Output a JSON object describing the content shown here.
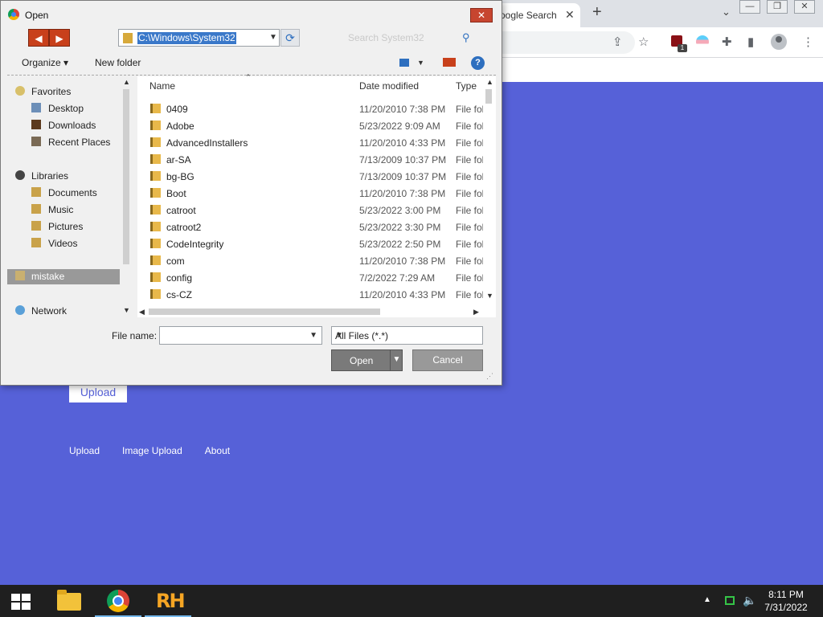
{
  "browser": {
    "tab_title": "oogle Search",
    "tab_close": "✕",
    "new_tab": "+",
    "page": {
      "upload_button": "Upload",
      "links": [
        "Upload",
        "Image Upload",
        "About"
      ]
    },
    "extension_badge": "1"
  },
  "dialog": {
    "title": "Open",
    "close_glyph": "✕",
    "address": "C:\\Windows\\System32",
    "search_placeholder": "Search System32",
    "toolbar": {
      "organize": "Organize ▾",
      "new_folder": "New folder",
      "help": "?"
    },
    "nav": {
      "favorites_header": "Favorites",
      "favorites": [
        "Desktop",
        "Downloads",
        "Recent Places"
      ],
      "libraries_header": "Libraries",
      "libraries": [
        "Documents",
        "Music",
        "Pictures",
        "Videos"
      ],
      "selected": "mistake",
      "network": "Network"
    },
    "columns": {
      "name": "Name",
      "date": "Date modified",
      "type": "Type"
    },
    "files": [
      {
        "name": "0409",
        "date": "11/20/2010 7:38 PM",
        "type": "File folder"
      },
      {
        "name": "Adobe",
        "date": "5/23/2022 9:09 AM",
        "type": "File folder"
      },
      {
        "name": "AdvancedInstallers",
        "date": "11/20/2010 4:33 PM",
        "type": "File folder"
      },
      {
        "name": "ar-SA",
        "date": "7/13/2009 10:37 PM",
        "type": "File folder"
      },
      {
        "name": "bg-BG",
        "date": "7/13/2009 10:37 PM",
        "type": "File folder"
      },
      {
        "name": "Boot",
        "date": "11/20/2010 7:38 PM",
        "type": "File folder"
      },
      {
        "name": "catroot",
        "date": "5/23/2022 3:00 PM",
        "type": "File folder"
      },
      {
        "name": "catroot2",
        "date": "5/23/2022 3:30 PM",
        "type": "File folder"
      },
      {
        "name": "CodeIntegrity",
        "date": "5/23/2022 2:50 PM",
        "type": "File folder"
      },
      {
        "name": "com",
        "date": "11/20/2010 7:38 PM",
        "type": "File folder"
      },
      {
        "name": "config",
        "date": "7/2/2022 7:29 AM",
        "type": "File folder"
      },
      {
        "name": "cs-CZ",
        "date": "11/20/2010 4:33 PM",
        "type": "File folder"
      }
    ],
    "file_name_label": "File name:",
    "file_name_value": "",
    "file_type": "All Files (*.*)",
    "open_button": "Open",
    "cancel_button": "Cancel"
  },
  "taskbar": {
    "time": "8:11 PM",
    "date": "7/31/2022",
    "rh_label": "RH"
  },
  "colors": {
    "page_background": "#5661d8",
    "taskbar": "#1f1f1f",
    "selection": "#3a78c9",
    "accent_orange": "#c8401b"
  }
}
